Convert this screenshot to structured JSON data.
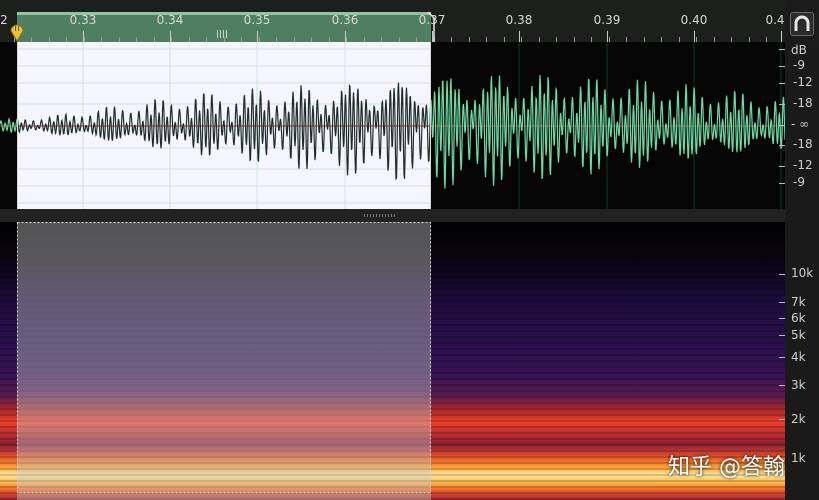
{
  "time_ruler": {
    "labels": [
      "2",
      "0.33",
      "0.34",
      "0.35",
      "0.36",
      "0.37",
      "0.38",
      "0.39",
      "0.40",
      "0.4"
    ],
    "playhead_marker_icon": "playhead-marker-icon"
  },
  "snap_button": {
    "icon": "snap-magnet-icon"
  },
  "amplitude_scale": {
    "unit": "dB",
    "labels": [
      "-9",
      "-12",
      "-18",
      "- ∞",
      "-18",
      "-12",
      "-9"
    ]
  },
  "frequency_scale": {
    "labels": [
      "10k",
      "7k",
      "6k",
      "5k",
      "4k",
      "3k",
      "2k",
      "1k"
    ]
  },
  "selection": {
    "start_s": 0.3205,
    "end_s": 0.3685
  },
  "colors": {
    "selection_background": "#f5f5ff",
    "waveform_selected": "#1f2e28",
    "waveform_unselected": "#6fd9a4",
    "center_line": "#b03a3a",
    "ruler_selection": "#4f7f60"
  },
  "watermark": "知乎 @答翰"
}
